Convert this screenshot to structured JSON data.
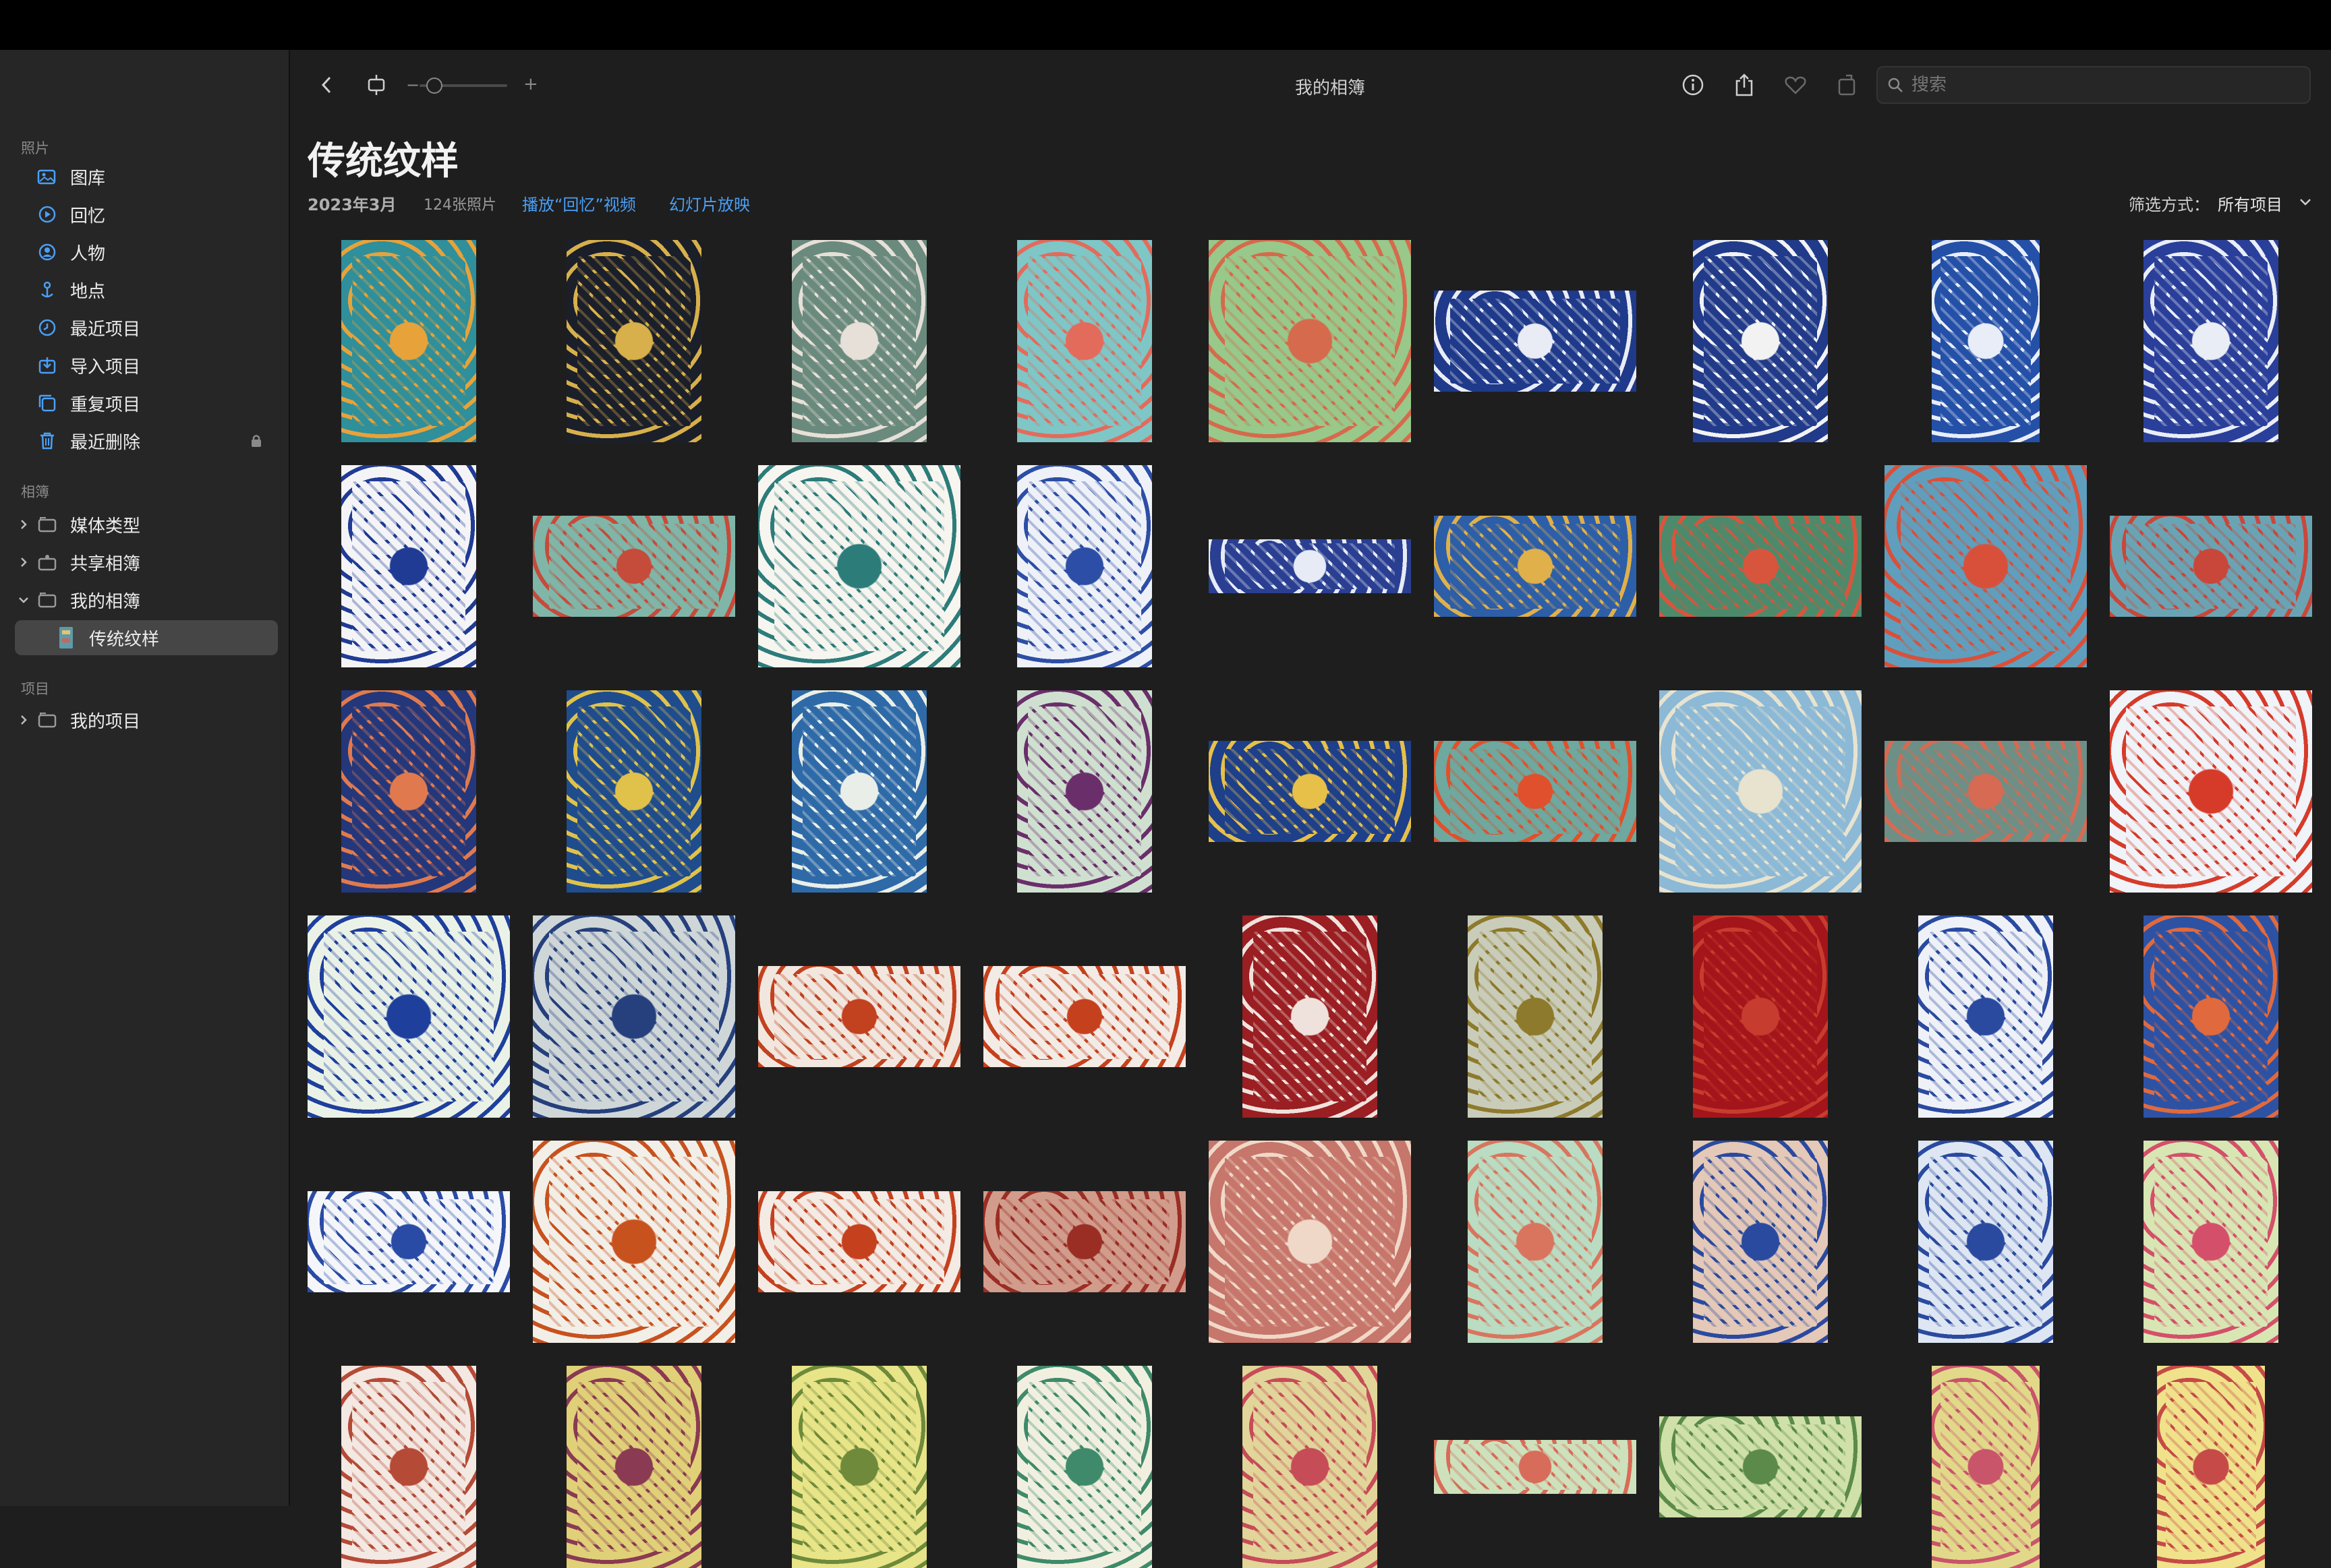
{
  "sidebar": {
    "section_photos": "照片",
    "photos_items": [
      {
        "label": "图库",
        "icon": "library-icon"
      },
      {
        "label": "回忆",
        "icon": "memories-icon"
      },
      {
        "label": "人物",
        "icon": "people-icon"
      },
      {
        "label": "地点",
        "icon": "places-icon"
      },
      {
        "label": "最近项目",
        "icon": "recents-icon"
      },
      {
        "label": "导入项目",
        "icon": "imports-icon"
      },
      {
        "label": "重复项目",
        "icon": "duplicates-icon"
      },
      {
        "label": "最近删除",
        "icon": "trash-icon"
      }
    ],
    "section_albums": "相簿",
    "album_items": [
      {
        "label": "媒体类型",
        "expanded": false
      },
      {
        "label": "共享相簿",
        "expanded": false
      },
      {
        "label": "我的相簿",
        "expanded": true
      }
    ],
    "selected_album": "传统纹样",
    "section_projects": "项目",
    "project_items": [
      {
        "label": "我的项目",
        "expanded": false
      }
    ]
  },
  "toolbar": {
    "window_title": "我的相簿",
    "zoom_minus": "−",
    "zoom_plus": "+",
    "search_placeholder": "搜索"
  },
  "header": {
    "title": "传统纹样",
    "date": "2023年3月",
    "count": "124张照片",
    "play_memory": "播放“回忆”视频",
    "slideshow": "幻灯片放映",
    "filter_label": "筛选方式：",
    "filter_value": "所有项目"
  },
  "colors": {
    "accent": "#4b9ff5",
    "selected_bg": "#464646"
  },
  "photos": [
    {
      "shape": "tall",
      "bg": "#2f8f9a",
      "fg": "#e8a23a"
    },
    {
      "shape": "tall",
      "bg": "#1b1f2a",
      "fg": "#d7b04b"
    },
    {
      "shape": "tall",
      "bg": "#6b8a7e",
      "fg": "#e6e0d8"
    },
    {
      "shape": "tall",
      "bg": "#7fc6c6",
      "fg": "#e36b5c"
    },
    {
      "shape": "square",
      "bg": "#98c88a",
      "fg": "#d66a4c"
    },
    {
      "shape": "wide",
      "bg": "#1f3a8a",
      "fg": "#e9ecf5"
    },
    {
      "shape": "tall",
      "bg": "#213b8a",
      "fg": "#f2f2f2"
    },
    {
      "shape": "narrow",
      "bg": "#2450a8",
      "fg": "#e8edf7"
    },
    {
      "shape": "tall",
      "bg": "#2a3f9a",
      "fg": "#e9edf6"
    },
    {
      "shape": "tall",
      "bg": "#f4f4f7",
      "fg": "#1f3b94"
    },
    {
      "shape": "wide",
      "bg": "#7fb6a8",
      "fg": "#c54b3b"
    },
    {
      "shape": "square",
      "bg": "#f7f5ef",
      "fg": "#2c7c7a"
    },
    {
      "shape": "tall",
      "bg": "#eef1f7",
      "fg": "#2d4ea6"
    },
    {
      "shape": "strip",
      "bg": "#2a3f92",
      "fg": "#e6ebf6"
    },
    {
      "shape": "wide",
      "bg": "#2d5ea8",
      "fg": "#e0b04a"
    },
    {
      "shape": "wide",
      "bg": "#4c8a6b",
      "fg": "#d8553d"
    },
    {
      "shape": "square",
      "bg": "#5f9fbd",
      "fg": "#d9503a"
    },
    {
      "shape": "wide",
      "bg": "#6aa4b4",
      "fg": "#c9473a"
    },
    {
      "shape": "tall",
      "bg": "#24377a",
      "fg": "#e07a4e"
    },
    {
      "shape": "tall",
      "bg": "#1f4c8c",
      "fg": "#e0c24b"
    },
    {
      "shape": "tall",
      "bg": "#2f6aa8",
      "fg": "#e9efe8"
    },
    {
      "shape": "tall",
      "bg": "#cfe0d0",
      "fg": "#6a2e6b"
    },
    {
      "shape": "wide",
      "bg": "#1e3f8a",
      "fg": "#e6c048"
    },
    {
      "shape": "wide",
      "bg": "#6ea89e",
      "fg": "#e0502c"
    },
    {
      "shape": "square",
      "bg": "#8cb9d6",
      "fg": "#e8e3cf"
    },
    {
      "shape": "wide",
      "bg": "#6e8f86",
      "fg": "#d76a52"
    },
    {
      "shape": "square",
      "bg": "#f0f3f8",
      "fg": "#d63b2a"
    },
    {
      "shape": "square",
      "bg": "#eaf2e8",
      "fg": "#1f3f9c"
    },
    {
      "shape": "square",
      "bg": "#cfd6d8",
      "fg": "#25407c"
    },
    {
      "shape": "wide",
      "bg": "#f1e7df",
      "fg": "#c2411f"
    },
    {
      "shape": "wide",
      "bg": "#f3ece6",
      "fg": "#c5411e"
    },
    {
      "shape": "tall",
      "bg": "#9a1e22",
      "fg": "#efe2dc"
    },
    {
      "shape": "tall",
      "bg": "#c9ccb9",
      "fg": "#8e7a2c"
    },
    {
      "shape": "tall",
      "bg": "#a3151a",
      "fg": "#c63c2e"
    },
    {
      "shape": "tall",
      "bg": "#eef1f7",
      "fg": "#2a4aa0"
    },
    {
      "shape": "tall",
      "bg": "#2d52a4",
      "fg": "#e06a3d"
    },
    {
      "shape": "wide",
      "bg": "#f4f6fa",
      "fg": "#2a4ba5"
    },
    {
      "shape": "square",
      "bg": "#f2efe8",
      "fg": "#c8521e"
    },
    {
      "shape": "wide",
      "bg": "#f3ebe4",
      "fg": "#c5411e"
    },
    {
      "shape": "wide",
      "bg": "#d19c8c",
      "fg": "#9a2d24"
    },
    {
      "shape": "square",
      "bg": "#c6766a",
      "fg": "#f0d8c8"
    },
    {
      "shape": "tall",
      "bg": "#b9dcc2",
      "fg": "#d9755e"
    },
    {
      "shape": "tall",
      "bg": "#e4c8b8",
      "fg": "#2a4aa0"
    },
    {
      "shape": "tall",
      "bg": "#dde6f2",
      "fg": "#2a4aa0"
    },
    {
      "shape": "tall",
      "bg": "#d8e6b4",
      "fg": "#d4506a"
    },
    {
      "shape": "tall",
      "bg": "#f3e8e2",
      "fg": "#b54a36"
    },
    {
      "shape": "tall",
      "bg": "#e0d078",
      "fg": "#8a3a52"
    },
    {
      "shape": "tall",
      "bg": "#e8e488",
      "fg": "#6e8a3a"
    },
    {
      "shape": "tall",
      "bg": "#f1f0e0",
      "fg": "#3f8a6a"
    },
    {
      "shape": "tall",
      "bg": "#e1d59a",
      "fg": "#c64c58"
    },
    {
      "shape": "strip",
      "bg": "#cde2bc",
      "fg": "#d86c5a"
    },
    {
      "shape": "wide",
      "bg": "#cfe0a8",
      "fg": "#5b8a4a"
    },
    {
      "shape": "narrow",
      "bg": "#e2d88a",
      "fg": "#c8556a"
    },
    {
      "shape": "narrow",
      "bg": "#f0e28a",
      "fg": "#c54a48"
    }
  ]
}
